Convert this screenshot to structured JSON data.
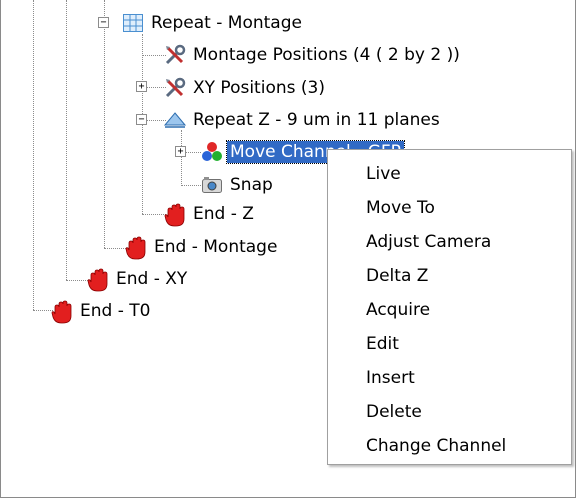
{
  "tree": {
    "nodes": [
      {
        "label": "Repeat - Montage",
        "icon": "grid-icon",
        "expander": "−"
      },
      {
        "label": "Montage Positions (4 ( 2 by 2 ))",
        "icon": "tools-icon"
      },
      {
        "label": "XY Positions (3)",
        "icon": "tools-icon",
        "expander": "+"
      },
      {
        "label": "Repeat Z - 9 um in 11 planes",
        "icon": "z-stack-icon",
        "expander": "−"
      },
      {
        "label": "Move Channel - GFP",
        "icon": "channels-icon",
        "expander": "+",
        "selected": true
      },
      {
        "label": "Snap",
        "icon": "camera-icon"
      },
      {
        "label": "End - Z",
        "icon": "stop-hand-icon"
      },
      {
        "label": "End - Montage",
        "icon": "stop-hand-icon"
      },
      {
        "label": "End - XY",
        "icon": "stop-hand-icon"
      },
      {
        "label": "End - T0",
        "icon": "stop-hand-icon"
      }
    ]
  },
  "context_menu": {
    "items": [
      "Live",
      "Move To",
      "Adjust Camera",
      "Delta Z",
      "Acquire",
      "Edit",
      "Insert",
      "Delete",
      "Change Channel"
    ]
  }
}
